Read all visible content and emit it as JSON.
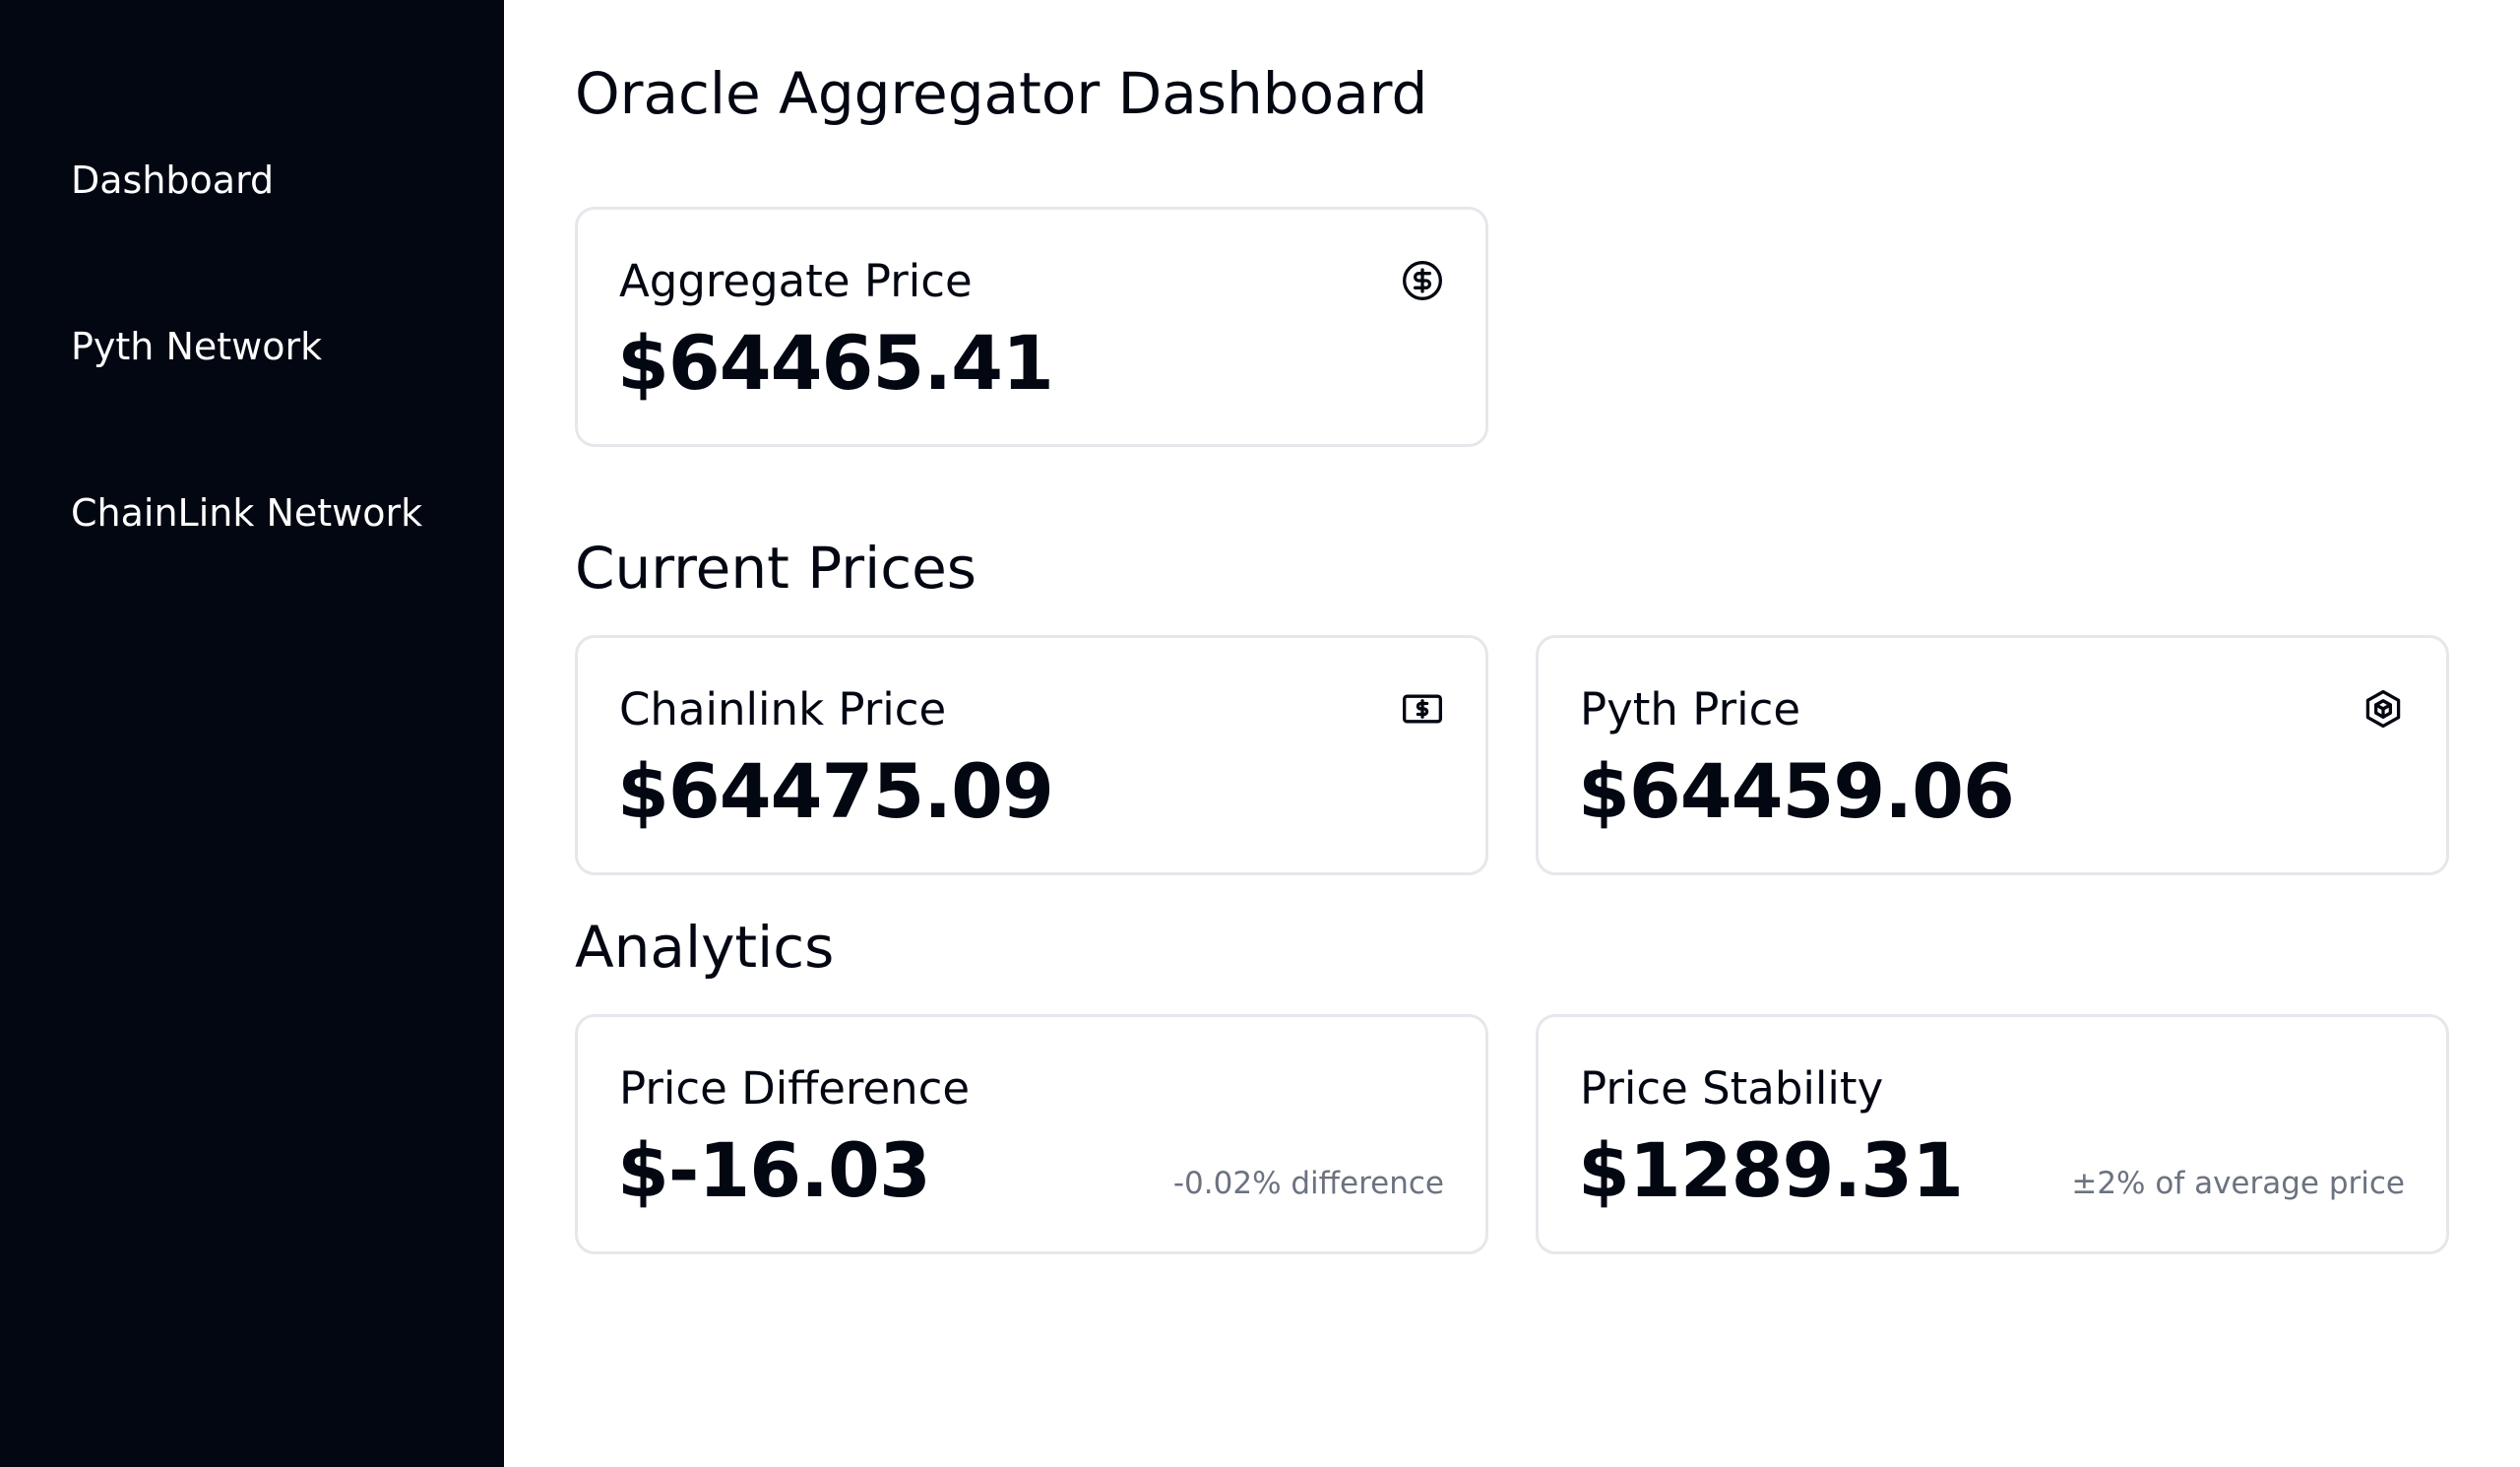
{
  "sidebar": {
    "items": [
      {
        "label": "Dashboard"
      },
      {
        "label": "Pyth Network"
      },
      {
        "label": "ChainLink Network"
      }
    ]
  },
  "main": {
    "title": "Oracle Aggregator Dashboard",
    "aggregate": {
      "label": "Aggregate Price",
      "value": "$64465.41",
      "icon": "dollar-circle-icon"
    },
    "current_prices": {
      "title": "Current Prices",
      "chainlink": {
        "label": "Chainlink Price",
        "value": "$64475.09",
        "icon": "banknote-icon"
      },
      "pyth": {
        "label": "Pyth Price",
        "value": "$64459.06",
        "icon": "box-icon"
      }
    },
    "analytics": {
      "title": "Analytics",
      "difference": {
        "label": "Price Difference",
        "value": "$-16.03",
        "note": "-0.02% difference"
      },
      "stability": {
        "label": "Price Stability",
        "value": "$1289.31",
        "note": "±2% of average price"
      }
    }
  },
  "colors": {
    "sidebar_bg": "#030712",
    "text": "#030712",
    "muted": "#6b7280",
    "border": "#e5e7eb"
  }
}
